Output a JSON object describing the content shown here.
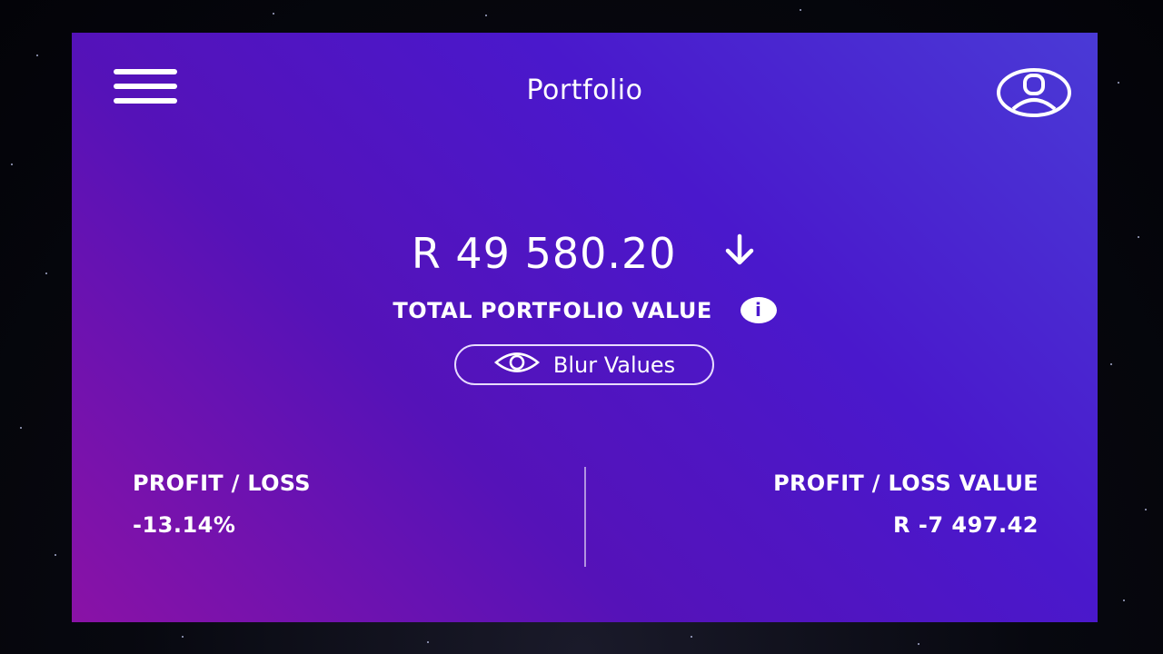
{
  "header": {
    "title": "Portfolio",
    "menu_icon": "hamburger-menu-icon",
    "profile_icon": "user-avatar-icon"
  },
  "portfolio": {
    "total_value": "R 49 580.20",
    "trend_icon": "arrow-down-icon",
    "total_label": "TOTAL PORTFOLIO VALUE",
    "info_icon": "info-icon",
    "info_glyph": "i"
  },
  "blur_button": {
    "label": "Blur Values",
    "icon": "eye-icon"
  },
  "stats": {
    "profit_loss_label": "PROFIT / LOSS",
    "profit_loss_percent": "-13.14%",
    "profit_loss_value_label": "PROFIT / LOSS VALUE",
    "profit_loss_value": "R -7 497.42"
  },
  "colors": {
    "gradient_top_right": "#4a3ad6",
    "gradient_mid": "#4a18cc",
    "gradient_bottom_left": "#8a12a6",
    "text": "#ffffff"
  }
}
